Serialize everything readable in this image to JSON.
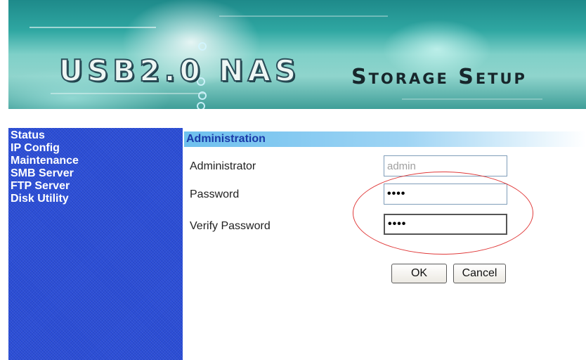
{
  "banner": {
    "title_usb": "USB2.0 NAS",
    "title_setup": "Storage Setup"
  },
  "sidebar": {
    "items": [
      {
        "label": "Status"
      },
      {
        "label": "IP Config"
      },
      {
        "label": "Maintenance"
      },
      {
        "label": "SMB Server"
      },
      {
        "label": "FTP Server"
      },
      {
        "label": "Disk Utility"
      }
    ]
  },
  "panel": {
    "title": "Administration",
    "fields": {
      "administrator": {
        "label": "Administrator",
        "value": "admin"
      },
      "password": {
        "label": "Password",
        "value": "••••"
      },
      "verify_password": {
        "label": "Verify Password",
        "value": "••••"
      }
    },
    "buttons": {
      "ok": "OK",
      "cancel": "Cancel"
    }
  },
  "colors": {
    "sidebar_bg": "#2b4ed6",
    "header_bg": "#6ec0ee",
    "annotation": "#e03a3a"
  }
}
